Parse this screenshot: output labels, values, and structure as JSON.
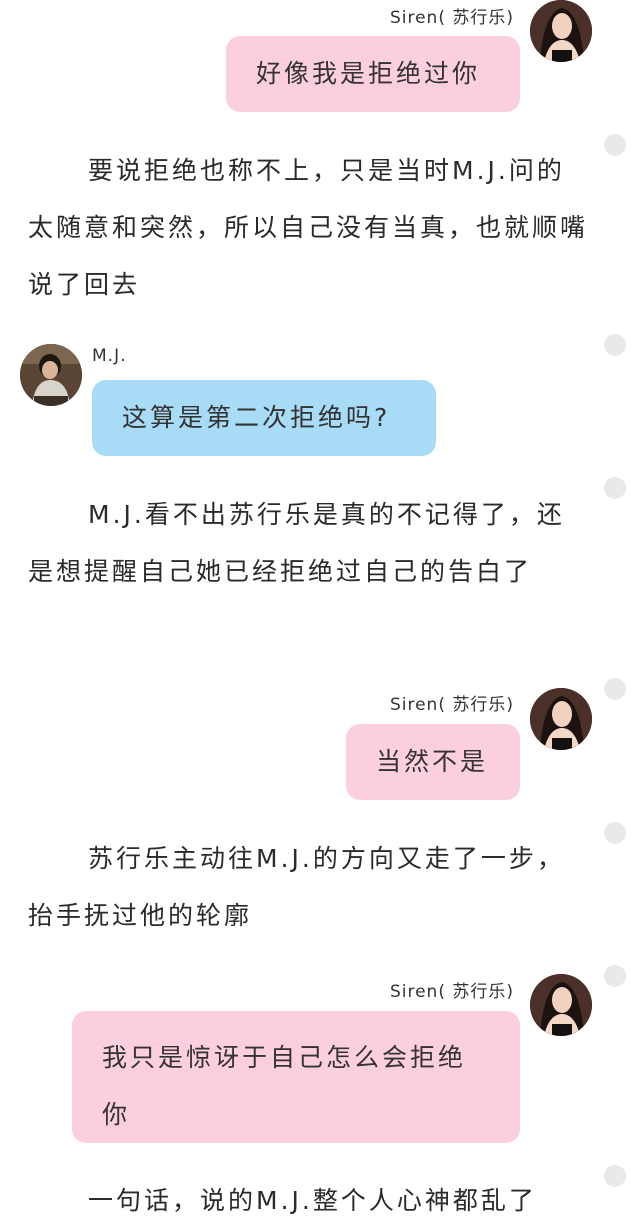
{
  "speakers": {
    "siren": {
      "name": "Siren( 苏行乐)"
    },
    "mj": {
      "name": "M.J."
    }
  },
  "messages": {
    "m1": "好像我是拒绝过你",
    "m2": "这算是第二次拒绝吗?",
    "m3": "当然不是",
    "m4": "我只是惊讶于自己怎么会拒绝你"
  },
  "narration": {
    "n1": "要说拒绝也称不上，只是当时M.J.问的太随意和突然，所以自己没有当真，也就顺嘴说了回去",
    "n2": "M.J.看不出苏行乐是真的不记得了，还是想提醒自己她已经拒绝过自己的告白了",
    "n3": "苏行乐主动往M.J.的方向又走了一步，抬手抚过他的轮廓",
    "n4": "一句话，说的M.J.整个人心神都乱了"
  },
  "colors": {
    "siren_bubble": "#fccfdc",
    "mj_bubble": "#a8dcf6",
    "marker_dot": "#e9e9e9"
  }
}
